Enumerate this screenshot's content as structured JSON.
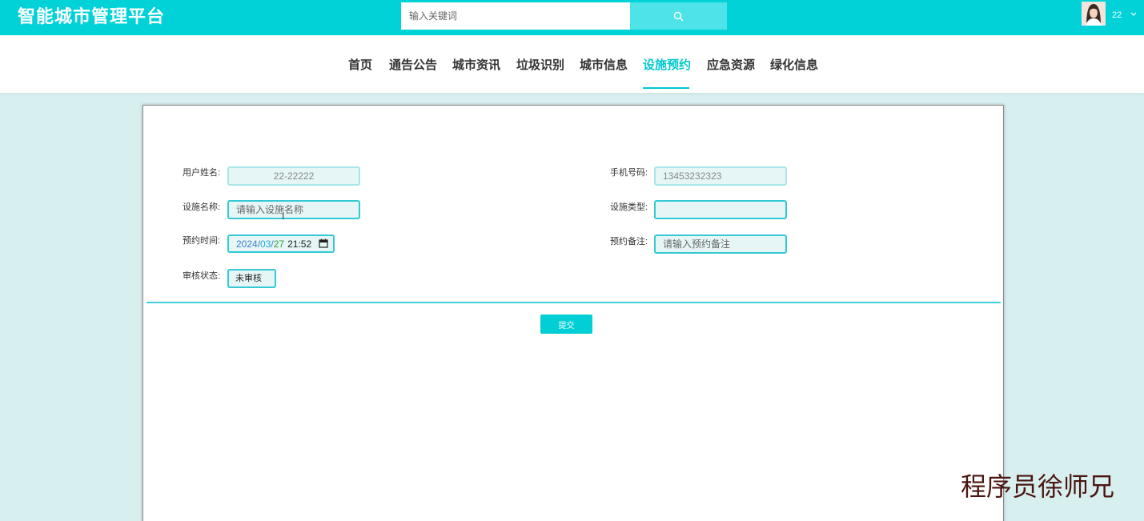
{
  "header": {
    "brand": "智能城市管理平台",
    "search_placeholder": "输入关键词",
    "username": "22"
  },
  "nav": {
    "items": [
      "首页",
      "通告公告",
      "城市资讯",
      "垃圾识别",
      "城市信息",
      "设施预约",
      "应急资源",
      "绿化信息"
    ],
    "active": "设施预约"
  },
  "form": {
    "username_label": "用户姓名:",
    "username_value": "22-22222",
    "phone_label": "手机号码:",
    "phone_value": "13453232323",
    "facility_name_label": "设施名称:",
    "facility_name_placeholder": "请输入设施名称",
    "facility_type_label": "设施类型:",
    "facility_type_value": "",
    "time_label": "预约时间:",
    "time_year": "2024",
    "time_sep1": "/",
    "time_month": "03",
    "time_sep2": "/",
    "time_day": "27",
    "time_clock": "21:52",
    "remark_label": "预约备注:",
    "remark_placeholder": "请输入预约备注",
    "status_label": "审核状态:",
    "status_value": "未审核",
    "submit_label": "提交"
  },
  "watermark": "程序员徐师兄",
  "colors": {
    "primary": "#00d2d8",
    "accent": "#00c8d0",
    "page_bg": "#d8eff0",
    "watermark": "#4a1510"
  }
}
